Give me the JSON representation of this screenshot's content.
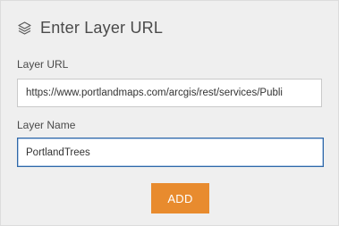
{
  "header": {
    "icon": "layers-icon",
    "title": "Enter Layer URL"
  },
  "form": {
    "url_label": "Layer URL",
    "url_value": "https://www.portlandmaps.com/arcgis/rest/services/Publi",
    "name_label": "Layer Name",
    "name_value": "PortlandTrees"
  },
  "actions": {
    "add_label": "ADD"
  },
  "colors": {
    "panel_bg": "#efefef",
    "accent": "#e88b2e",
    "focus_border": "#2f68a8"
  }
}
